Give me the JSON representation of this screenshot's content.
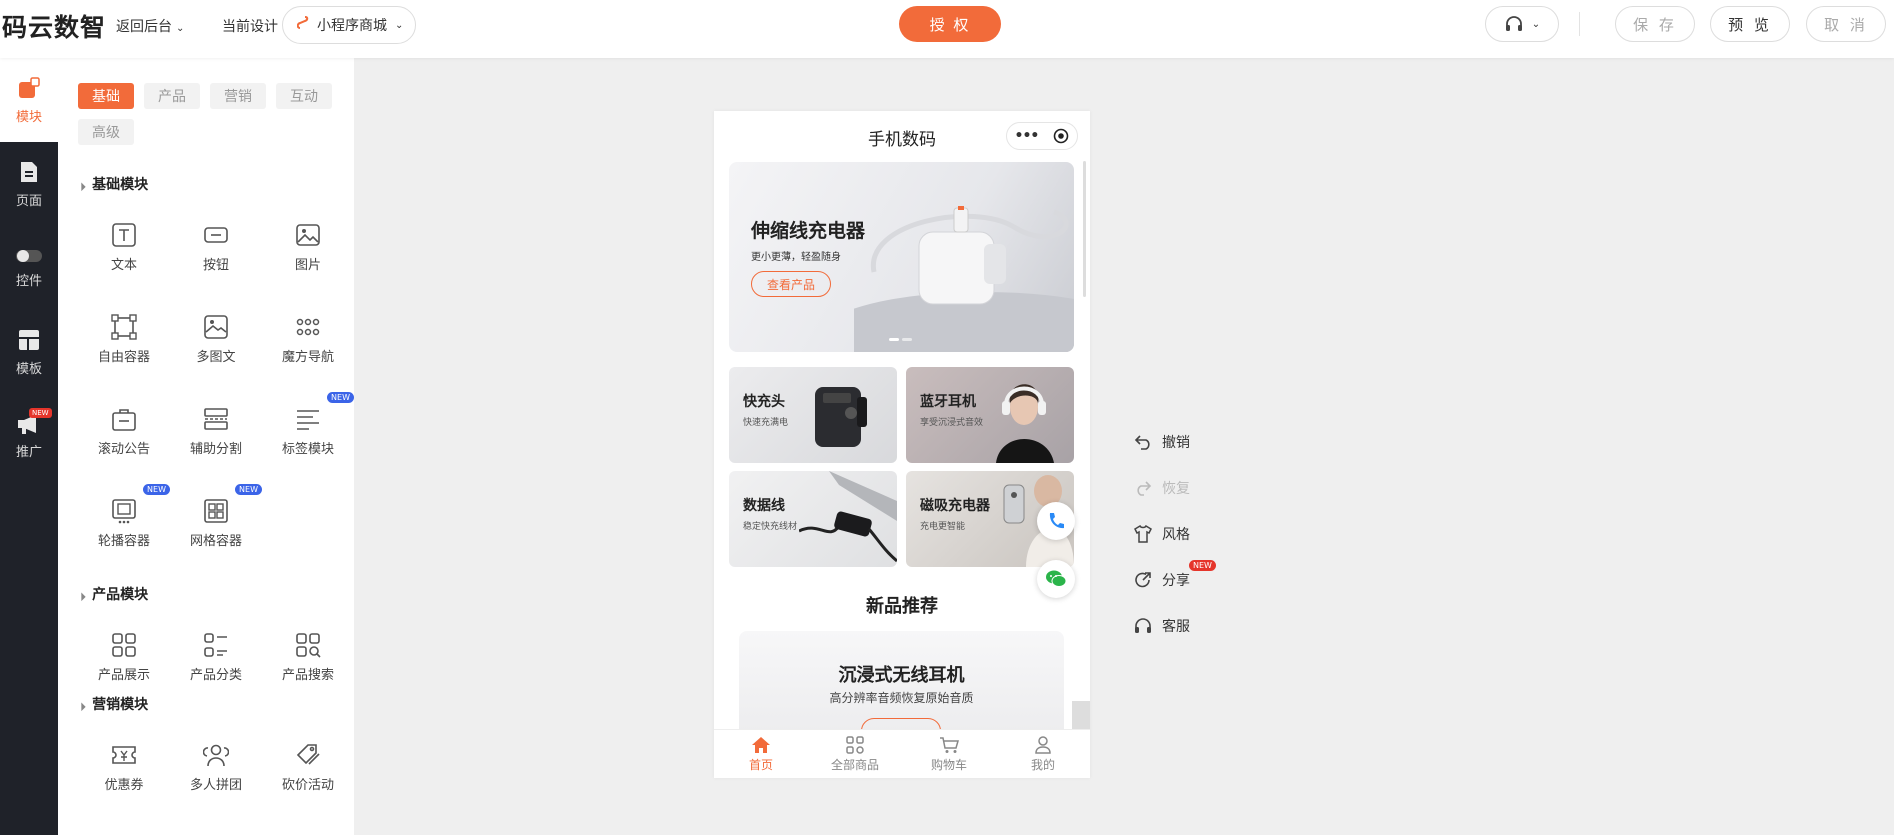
{
  "topbar": {
    "logo": "码云数智",
    "back_label": "返回后台",
    "current_design_label": "当前设计",
    "app_name": "小程序商城",
    "authorize_label": "授 权",
    "save_label": "保 存",
    "preview_label": "预 览",
    "cancel_label": "取 消"
  },
  "rail": {
    "items": [
      {
        "label": "模块",
        "icon": "blocks-icon"
      },
      {
        "label": "页面",
        "icon": "page-icon"
      },
      {
        "label": "控件",
        "icon": "toggle-icon"
      },
      {
        "label": "模板",
        "icon": "template-icon"
      },
      {
        "label": "推广",
        "icon": "megaphone-icon",
        "badge": "NEW"
      }
    ]
  },
  "panel": {
    "tabs": [
      "基础",
      "产品",
      "营销",
      "互动",
      "高级"
    ],
    "sections": [
      {
        "title": "基础模块",
        "modules": [
          {
            "label": "文本",
            "icon": "text-icon"
          },
          {
            "label": "按钮",
            "icon": "button-icon"
          },
          {
            "label": "图片",
            "icon": "image-icon"
          },
          {
            "label": "自由容器",
            "icon": "free-container-icon"
          },
          {
            "label": "多图文",
            "icon": "multi-image-icon"
          },
          {
            "label": "魔方导航",
            "icon": "grid-dots-icon"
          },
          {
            "label": "滚动公告",
            "icon": "notice-icon"
          },
          {
            "label": "辅助分割",
            "icon": "divider-icon"
          },
          {
            "label": "标签模块",
            "icon": "tag-lines-icon",
            "badge": "NEW"
          },
          {
            "label": "轮播容器",
            "icon": "carousel-icon",
            "badge": "NEW"
          },
          {
            "label": "网格容器",
            "icon": "grid-container-icon",
            "badge": "NEW"
          }
        ]
      },
      {
        "title": "产品模块",
        "modules": [
          {
            "label": "产品展示",
            "icon": "product-grid-icon"
          },
          {
            "label": "产品分类",
            "icon": "product-list-icon"
          },
          {
            "label": "产品搜索",
            "icon": "product-search-icon"
          }
        ]
      },
      {
        "title": "营销模块",
        "modules": [
          {
            "label": "优惠券",
            "icon": "coupon-icon"
          },
          {
            "label": "多人拼团",
            "icon": "group-buy-icon"
          },
          {
            "label": "砍价活动",
            "icon": "bargain-icon"
          }
        ]
      }
    ]
  },
  "phone": {
    "title": "手机数码",
    "banner": {
      "title": "伸缩线充电器",
      "subtitle": "更小更薄，轻盈随身",
      "button": "查看产品"
    },
    "cards": [
      {
        "title": "快充头",
        "subtitle": "快速充满电"
      },
      {
        "title": "蓝牙耳机",
        "subtitle": "享受沉浸式音效"
      },
      {
        "title": "数据线",
        "subtitle": "稳定快充线材"
      },
      {
        "title": "磁吸充电器",
        "subtitle": "充电更智能"
      }
    ],
    "section_title": "新品推荐",
    "promo": {
      "title": "沉浸式无线耳机",
      "subtitle": "高分辨率音频恢复原始音质"
    },
    "tabbar": [
      {
        "label": "首页",
        "icon": "home-icon",
        "active": true
      },
      {
        "label": "全部商品",
        "icon": "all-products-icon"
      },
      {
        "label": "购物车",
        "icon": "cart-icon"
      },
      {
        "label": "我的",
        "icon": "user-icon"
      }
    ]
  },
  "actions": {
    "items": [
      {
        "label": "撤销",
        "icon": "undo-icon",
        "disabled": false
      },
      {
        "label": "恢复",
        "icon": "redo-icon",
        "disabled": true
      },
      {
        "label": "风格",
        "icon": "shirt-icon",
        "disabled": false
      },
      {
        "label": "分享",
        "icon": "share-icon",
        "disabled": false,
        "badge": "NEW"
      },
      {
        "label": "客服",
        "icon": "headset-icon",
        "disabled": false
      }
    ]
  },
  "colors": {
    "accent": "#f26b3a",
    "rail_bg": "#1f2229",
    "new_badge_blue": "#3b64e8",
    "new_badge_red": "#e5352b"
  }
}
